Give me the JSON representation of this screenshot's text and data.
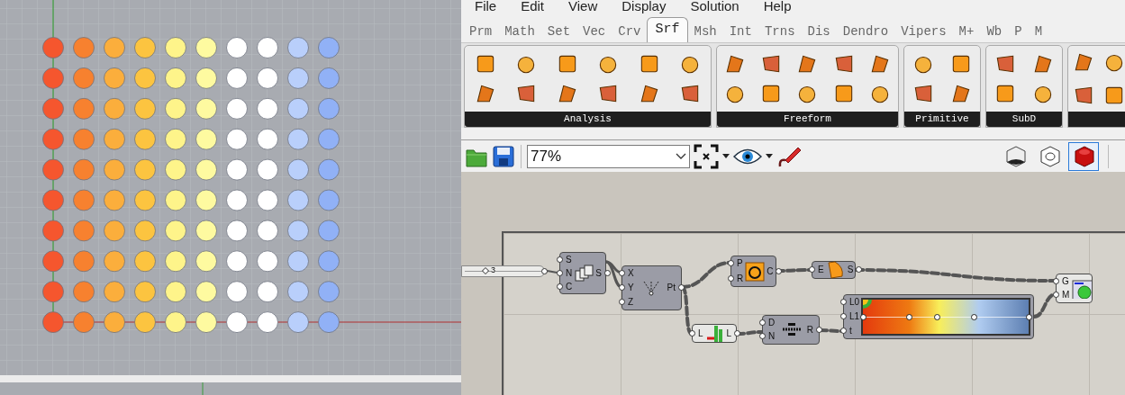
{
  "viewport": {
    "columns": [
      {
        "color": "#f5562e"
      },
      {
        "color": "#f7812f"
      },
      {
        "color": "#fbae3c"
      },
      {
        "color": "#fcc440"
      },
      {
        "color": "#fef48a"
      },
      {
        "color": "#fefaa0"
      },
      {
        "color": "#ffffff"
      },
      {
        "color": "#ffffff"
      },
      {
        "color": "#b9cffb"
      },
      {
        "color": "#91b1f6"
      }
    ]
  },
  "menu": [
    "File",
    "Edit",
    "View",
    "Display",
    "Solution",
    "Help"
  ],
  "tabs": [
    {
      "label": "Prm",
      "selected": false
    },
    {
      "label": "Math",
      "selected": false
    },
    {
      "label": "Set",
      "selected": false
    },
    {
      "label": "Vec",
      "selected": false
    },
    {
      "label": "Crv",
      "selected": false
    },
    {
      "label": "Srf",
      "selected": true
    },
    {
      "label": "Msh",
      "selected": false
    },
    {
      "label": "Int",
      "selected": false
    },
    {
      "label": "Trns",
      "selected": false
    },
    {
      "label": "Dis",
      "selected": false
    },
    {
      "label": "Dendro",
      "selected": false
    },
    {
      "label": "Vipers",
      "selected": false
    },
    {
      "label": "M+",
      "selected": false
    },
    {
      "label": "Wb",
      "selected": false
    },
    {
      "label": "P",
      "selected": false
    },
    {
      "label": "M",
      "selected": false
    }
  ],
  "panels": [
    {
      "title": "Analysis"
    },
    {
      "title": "Freeform"
    },
    {
      "title": "Primitive"
    },
    {
      "title": "SubD"
    }
  ],
  "toolbar": {
    "zoom": "77%",
    "preview_modes": [
      {
        "selected": false
      },
      {
        "selected": false
      },
      {
        "selected": true
      }
    ]
  },
  "nodes": [
    {
      "kind": "slider",
      "value": "3",
      "level": 0.27
    },
    {
      "kind": "series",
      "inputs": [
        "S",
        "N",
        "C"
      ],
      "outputs": [
        "S"
      ]
    },
    {
      "kind": "point",
      "inputs": [
        "X",
        "Y",
        "Z"
      ],
      "outputs": [
        "Pt"
      ]
    },
    {
      "kind": "circle",
      "inputs": [
        "P",
        "R"
      ],
      "outputs": [
        "C"
      ]
    },
    {
      "kind": "surface",
      "inputs": [
        "E"
      ],
      "outputs": [
        "S"
      ]
    },
    {
      "kind": "gradient",
      "inputs": [
        "L0",
        "L1",
        "t"
      ]
    },
    {
      "kind": "preview",
      "inputs": [
        "G",
        "M"
      ]
    },
    {
      "kind": "list",
      "inputs": [
        "L"
      ],
      "outputs": [
        "L"
      ]
    },
    {
      "kind": "range",
      "inputs": [
        "D",
        "N"
      ],
      "outputs": [
        "R"
      ]
    }
  ]
}
